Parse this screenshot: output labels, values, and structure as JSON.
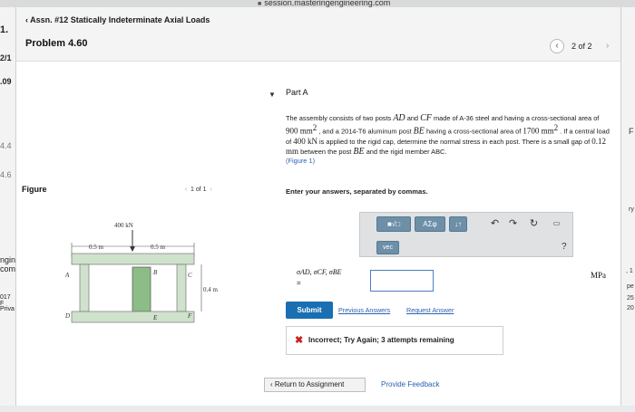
{
  "browser": {
    "url": "session.masteringengineering.com"
  },
  "left_strip": {
    "items": [
      "1.",
      "2/1",
      ".09",
      "4.4",
      "4.6",
      "ngin",
      "com",
      "017 F",
      "Priva"
    ]
  },
  "right_strip": {
    "items": [
      "F",
      "ry",
      ", 1",
      "pe",
      "25",
      "20"
    ]
  },
  "header": {
    "back_label": "Assn. #12 Statically Indeterminate Axial Loads",
    "problem_title": "Problem 4.60",
    "pager": "2 of 2"
  },
  "part": {
    "label": "Part A",
    "description": {
      "t1": "The assembly consists of two posts ",
      "ad": "AD",
      "t2": " and ",
      "cf": "CF",
      "t3": " made of A-36 steel and having a cross-sectional area of ",
      "area1": "900 mm",
      "t4": " , and a 2014-T6 aluminum post ",
      "be": "BE",
      "t5": " having a cross-sectional area of ",
      "area2": "1700 mm",
      "sq": "2",
      "t6": " . If a central load of ",
      "load": "400 kN",
      "t7": " is applied to the rigid cap, determine the normal stress in each post. There is a small gap of ",
      "gap": "0.12 mm",
      "t8": " between the post ",
      "be2": "BE",
      "t9": " and the rigid member ABC.",
      "figure_ref": "(Figure 1)"
    },
    "instructions": "Enter your answers, separated by commas."
  },
  "figure": {
    "label": "Figure",
    "pager": "1 of 1",
    "load_label": "400 kN",
    "dim1": "0.5 m",
    "dim2": "0.5 m",
    "height": "0.4 m",
    "points": {
      "A": "A",
      "B": "B",
      "C": "C",
      "D": "D",
      "E": "E",
      "F": "F"
    }
  },
  "answer_toolbar": {
    "templates_btn": "■√□",
    "greek_btn": "ΑΣφ",
    "sort_btn": "↓↑",
    "undo_icon": "undo-icon",
    "redo_icon": "redo-icon",
    "reset_icon": "reset-icon",
    "keyboard_icon": "keyboard-icon",
    "vec_btn": "vec",
    "help": "?"
  },
  "answer": {
    "label": "σAD, σCF, σBE",
    "equals": "=",
    "value": "",
    "unit": "MPa"
  },
  "actions": {
    "submit": "Submit",
    "previous_answers": "Previous Answers",
    "request_answer": "Request Answer"
  },
  "feedback": {
    "text": "Incorrect; Try Again; 3 attempts remaining"
  },
  "footer": {
    "return_label": "Return to Assignment",
    "provide_feedback": "Provide Feedback"
  },
  "colors": {
    "submit_bg": "#1a6fb3",
    "link": "#2a62b0",
    "error": "#cc1f1f",
    "toolbar_btn": "#6d8fa8",
    "figure_fill": "#cfe2cc"
  }
}
